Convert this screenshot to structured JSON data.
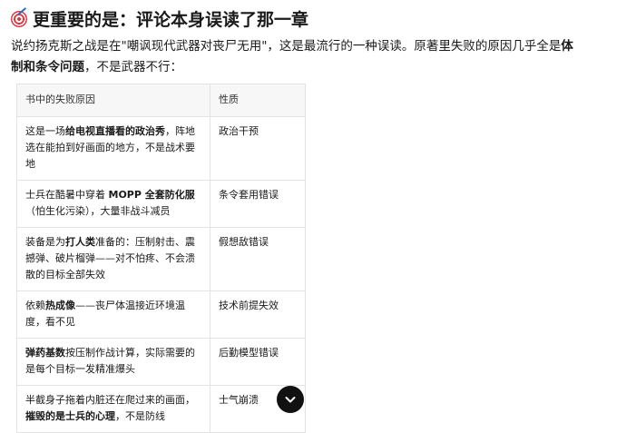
{
  "heading": {
    "icon": "target-icon",
    "text": "更重要的是：评论本身误读了那一章"
  },
  "intro": {
    "p1": "说约扬克斯之战是在\"嘲讽现代武器对丧尸无用\"，这是最流行的一种误读。原著里失败的原因几乎全是",
    "p1_bold": "体制和条令问题",
    "p1_end": "，不是武器不行："
  },
  "table": {
    "headers": [
      "书中的失败原因",
      "性质"
    ],
    "rows": [
      {
        "cause": [
          {
            "t": "这是一场"
          },
          {
            "t": "给电视直播看的政治秀",
            "b": true
          },
          {
            "t": "，阵地选在能拍到好画面的地方，不是战术要地"
          }
        ],
        "nature": "政治干预"
      },
      {
        "cause": [
          {
            "t": "士兵在酷暑中穿着 "
          },
          {
            "t": "MOPP 全套防化服",
            "b": true
          },
          {
            "t": "（怕生化污染），大量非战斗减员"
          }
        ],
        "nature": "条令套用错误"
      },
      {
        "cause": [
          {
            "t": "装备是为"
          },
          {
            "t": "打人类",
            "b": true
          },
          {
            "t": "准备的：压制射击、震撼弹、破片榴弹——对不怕疼、不会溃散的目标全部失效"
          }
        ],
        "nature": "假想敌错误"
      },
      {
        "cause": [
          {
            "t": "依赖"
          },
          {
            "t": "热成像",
            "b": true
          },
          {
            "t": "——丧尸体温接近环境温度，看不见"
          }
        ],
        "nature": "技术前提失效"
      },
      {
        "cause": [
          {
            "t": "弹药基数",
            "b": true
          },
          {
            "t": "按压制作战计算，实际需要的是每个目标一发精准爆头"
          }
        ],
        "nature": "后勤模型错误"
      },
      {
        "cause": [
          {
            "t": "半截身子拖着内脏还在爬过来的画面，"
          },
          {
            "t": "摧毁的是士兵的心理",
            "b": true
          },
          {
            "t": "，不是防线"
          }
        ],
        "nature": "士气崩溃"
      }
    ]
  },
  "scroll_button": {
    "icon": "chevron-down-icon"
  }
}
